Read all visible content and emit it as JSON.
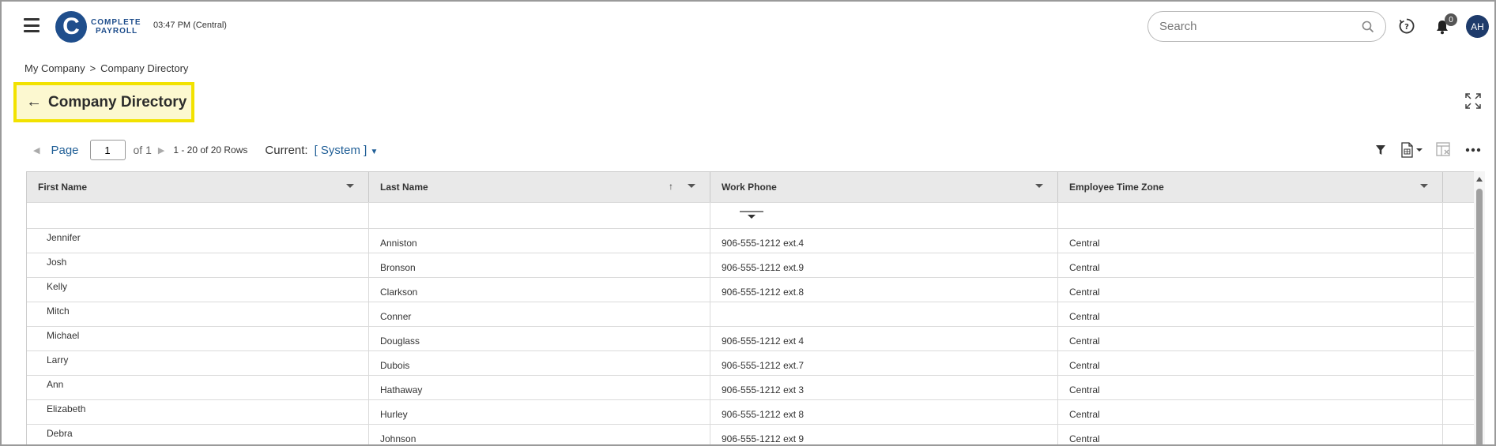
{
  "header": {
    "menu_icon": "hamburger-icon",
    "logo": {
      "letter": "C",
      "line1": "COMPLETE",
      "line2": "PAYROLL"
    },
    "clock": "03:47 PM (Central)",
    "search": {
      "placeholder": "Search",
      "value": ""
    },
    "help_icon": "help-icon",
    "notifications": {
      "icon": "bell-icon",
      "count": "0"
    },
    "avatar_initials": "AH"
  },
  "breadcrumb": {
    "items": [
      "My Company",
      "Company Directory"
    ],
    "separator": ">"
  },
  "page": {
    "title": "Company Directory",
    "back_icon": "arrow-left-icon",
    "expand_icon": "expand-icon"
  },
  "pager": {
    "page_label": "Page",
    "page_value": "1",
    "of_label": "of 1",
    "rows_label": "1 - 20 of 20 Rows",
    "current_label": "Current:",
    "view_label": "[ System ]"
  },
  "tools": {
    "filter_icon": "filter-icon",
    "export_icon": "export-document-icon",
    "columns_icon": "column-chooser-icon",
    "more_icon": "more-icon"
  },
  "grid": {
    "columns": [
      "First Name",
      "Last Name",
      "Work Phone",
      "Employee Time Zone"
    ],
    "sorted_column": "Last Name",
    "sort_direction": "ascending",
    "rows": [
      [
        "Jennifer",
        "Anniston",
        "906-555-1212 ext.4",
        "Central"
      ],
      [
        "Josh",
        "Bronson",
        "906-555-1212 ext.9",
        "Central"
      ],
      [
        "Kelly",
        "Clarkson",
        "906-555-1212 ext.8",
        "Central"
      ],
      [
        "Mitch",
        "Conner",
        "",
        "Central"
      ],
      [
        "Michael",
        "Douglass",
        "906-555-1212 ext 4",
        "Central"
      ],
      [
        "Larry",
        "Dubois",
        "906-555-1212 ext.7",
        "Central"
      ],
      [
        "Ann",
        "Hathaway",
        "906-555-1212 ext 3",
        "Central"
      ],
      [
        "Elizabeth",
        "Hurley",
        "906-555-1212 ext 8",
        "Central"
      ],
      [
        "Debra",
        "Johnson",
        "906-555-1212 ext 9",
        "Central"
      ]
    ]
  },
  "colors": {
    "brand": "#1f4e8c",
    "link": "#1f5e96",
    "highlight_border": "#f2e200",
    "highlight_fill": "#fcf8d0"
  }
}
